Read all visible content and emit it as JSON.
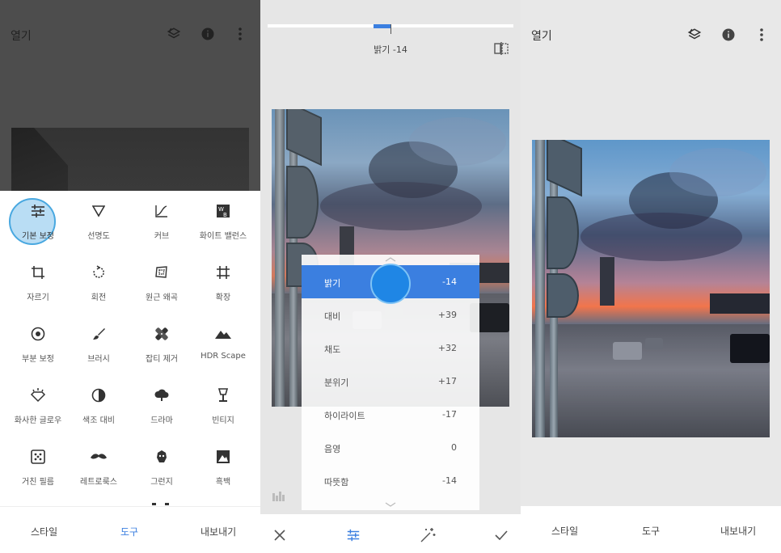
{
  "panel1": {
    "title": "열기",
    "tools": [
      {
        "label": "기본 보정",
        "icon": "tune-icon",
        "active": true
      },
      {
        "label": "선명도",
        "icon": "triangle-icon"
      },
      {
        "label": "커브",
        "icon": "curves-icon"
      },
      {
        "label": "화이트 밸런스",
        "icon": "white-balance-icon"
      },
      {
        "label": "자르기",
        "icon": "crop-icon"
      },
      {
        "label": "회전",
        "icon": "rotate-icon"
      },
      {
        "label": "원근 왜곡",
        "icon": "perspective-icon"
      },
      {
        "label": "확장",
        "icon": "expand-icon"
      },
      {
        "label": "부분 보정",
        "icon": "selective-icon"
      },
      {
        "label": "브러시",
        "icon": "brush-icon"
      },
      {
        "label": "잡티 제거",
        "icon": "healing-icon"
      },
      {
        "label": "HDR Scape",
        "icon": "mountain-icon"
      },
      {
        "label": "화사한 글로우",
        "icon": "glamour-glow-icon"
      },
      {
        "label": "색조 대비",
        "icon": "tonal-contrast-icon"
      },
      {
        "label": "드라마",
        "icon": "drama-cloud-icon"
      },
      {
        "label": "빈티지",
        "icon": "vintage-lamp-icon"
      },
      {
        "label": "거친 필름",
        "icon": "grainy-film-icon"
      },
      {
        "label": "레트로룩스",
        "icon": "mustache-icon"
      },
      {
        "label": "그런지",
        "icon": "grunge-icon"
      },
      {
        "label": "흑백",
        "icon": "black-white-icon"
      }
    ],
    "nav": {
      "styles": "스타일",
      "tools": "도구",
      "export": "내보내기"
    },
    "accent": "#3b7fe0"
  },
  "panel2": {
    "slider_label": "밝기 -14",
    "slider_value": -14,
    "adjustments": [
      {
        "name": "밝기",
        "value": "-14",
        "selected": true
      },
      {
        "name": "대비",
        "value": "+39"
      },
      {
        "name": "채도",
        "value": "+32"
      },
      {
        "name": "분위기",
        "value": "+17"
      },
      {
        "name": "하이라이트",
        "value": "-17"
      },
      {
        "name": "음영",
        "value": "0"
      },
      {
        "name": "따뜻함",
        "value": "-14"
      }
    ]
  },
  "panel3": {
    "title": "열기",
    "nav": {
      "styles": "스타일",
      "tools": "도구",
      "export": "내보내기"
    }
  }
}
